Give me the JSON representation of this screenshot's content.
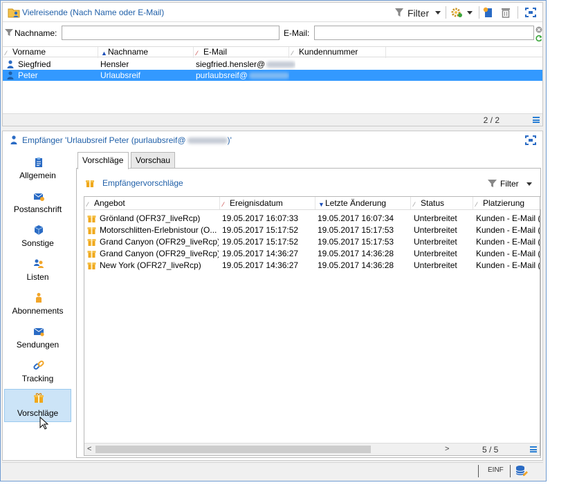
{
  "list_panel": {
    "title": "Vielreisende (Nach Name oder E-Mail)",
    "toolbar": {
      "filter_label": "Filter"
    },
    "search": {
      "lastname_label": "Nachname:",
      "lastname_value": "",
      "email_label": "E-Mail:",
      "email_value": ""
    },
    "columns": [
      "Vorname",
      "Nachname",
      "E-Mail",
      "Kundennummer"
    ],
    "rows": [
      {
        "first": "Siegfried",
        "last": "Hensler",
        "email": "siegfried.hensler@",
        "customer_no": ""
      },
      {
        "first": "Peter",
        "last": "Urlaubsreif",
        "email": "purlaubsreif@",
        "customer_no": ""
      }
    ],
    "pager": "2 / 2"
  },
  "detail": {
    "title_prefix": "Empfänger 'Urlaubsreif Peter (purlaubsreif@",
    "title_suffix": ")'",
    "sidebar": [
      {
        "label": "Allgemein",
        "icon": "clipboard-icon"
      },
      {
        "label": "Postanschrift",
        "icon": "mailbox-icon"
      },
      {
        "label": "Sonstige",
        "icon": "cube-icon"
      },
      {
        "label": "Listen",
        "icon": "users-list-icon"
      },
      {
        "label": "Abonnements",
        "icon": "subscription-icon"
      },
      {
        "label": "Sendungen",
        "icon": "envelope-icon"
      },
      {
        "label": "Tracking",
        "icon": "link-icon"
      },
      {
        "label": "Vorschläge",
        "icon": "gift-icon"
      }
    ],
    "active_sidebar": "Vorschläge",
    "tabs": [
      "Vorschläge",
      "Vorschau"
    ],
    "pane": {
      "title": "Empfängervorschläge",
      "filter_label": "Filter",
      "columns": [
        "Angebot",
        "Ereignisdatum",
        "Letzte Änderung",
        "Status",
        "Platzierung"
      ],
      "rows": [
        {
          "offer": "Grönland (OFR37_liveRcp)",
          "event": "19.05.2017 16:07:33",
          "changed": "19.05.2017 16:07:34",
          "status": "Unterbreitet",
          "placement": "Kunden - E-Mail ("
        },
        {
          "offer": "Motorschlitten-Erlebnistour (O...",
          "event": "19.05.2017 15:17:52",
          "changed": "19.05.2017 15:17:53",
          "status": "Unterbreitet",
          "placement": "Kunden - E-Mail ("
        },
        {
          "offer": "Grand Canyon (OFR29_liveRcp)",
          "event": "19.05.2017 15:17:52",
          "changed": "19.05.2017 15:17:53",
          "status": "Unterbreitet",
          "placement": "Kunden - E-Mail ("
        },
        {
          "offer": "Grand Canyon (OFR29_liveRcp)",
          "event": "19.05.2017 14:36:27",
          "changed": "19.05.2017 14:36:28",
          "status": "Unterbreitet",
          "placement": "Kunden - E-Mail ("
        },
        {
          "offer": "New York (OFR27_liveRcp)",
          "event": "19.05.2017 14:36:27",
          "changed": "19.05.2017 14:36:28",
          "status": "Unterbreitet",
          "placement": "Kunden - E-Mail ("
        }
      ],
      "pager": "5 / 5"
    }
  },
  "statusbar": {
    "mode": "EINF"
  },
  "colors": {
    "accent": "#1f5fa8",
    "selection": "#3399ff",
    "active_sidebar_bg": "#cce4f7",
    "gift": "#f0a81c"
  }
}
